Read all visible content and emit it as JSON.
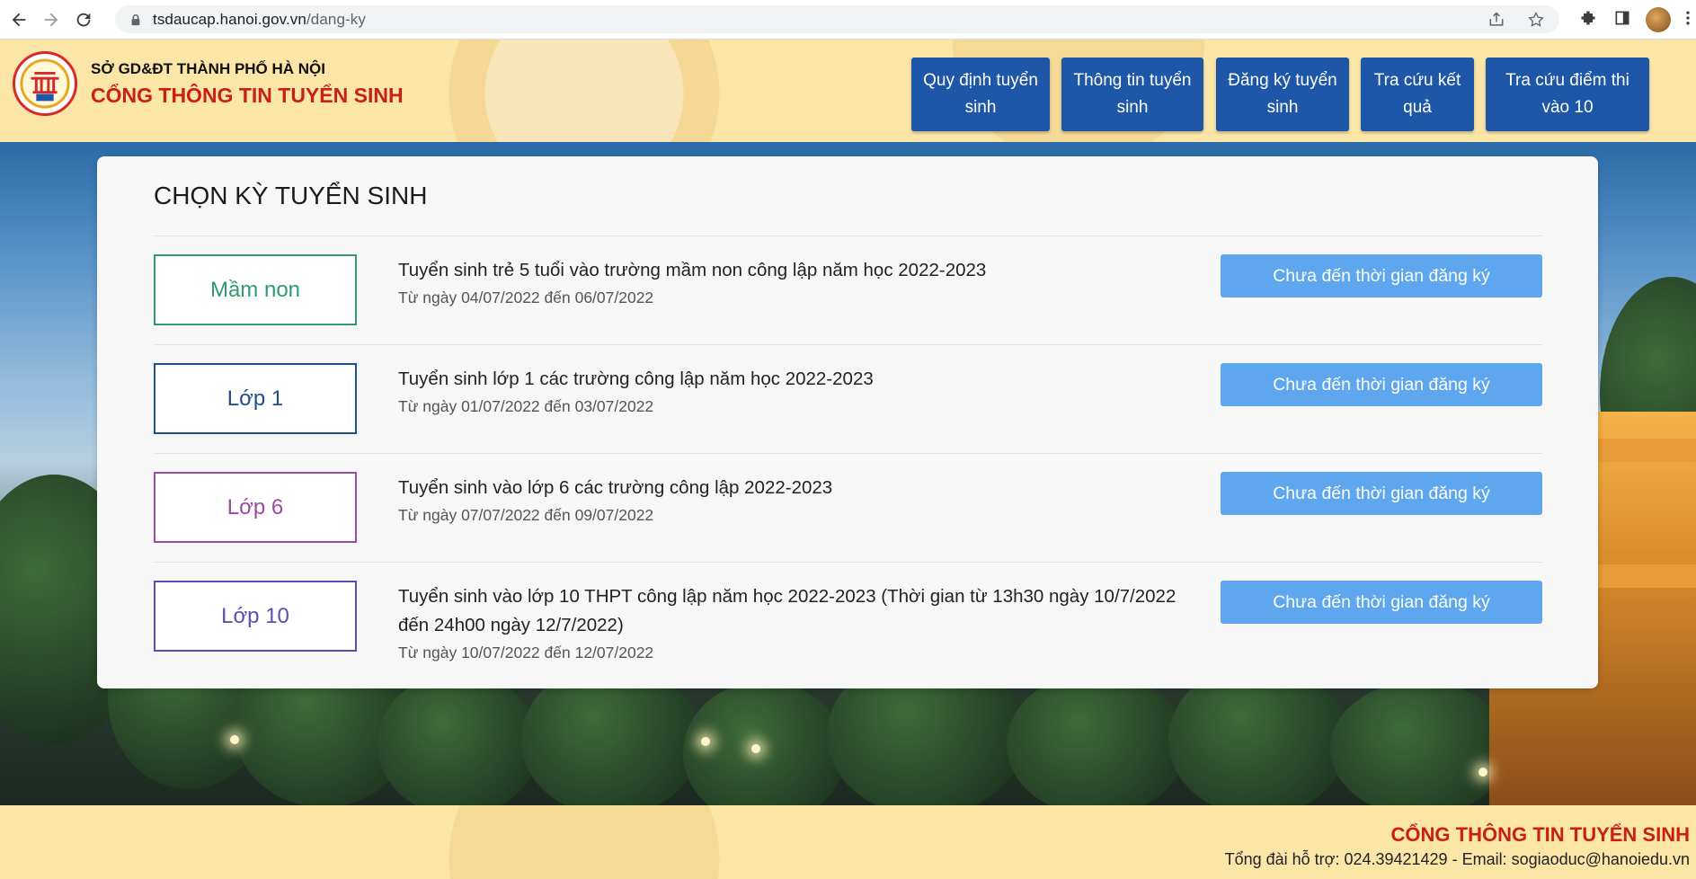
{
  "browser": {
    "url_host": "tsdaucap.hanoi.gov.vn",
    "url_path": "/dang-ky"
  },
  "header": {
    "org_name": "SỞ GD&ĐT THÀNH PHỐ HÀ NỘI",
    "portal_name": "CỔNG THÔNG TIN TUYỂN SINH",
    "nav": [
      {
        "label": "Quy định tuyển sinh"
      },
      {
        "label": "Thông tin tuyển sinh"
      },
      {
        "label": "Đăng ký tuyển sinh"
      },
      {
        "label": "Tra cứu kết quả"
      },
      {
        "label": "Tra cứu điểm thi vào 10"
      }
    ]
  },
  "main": {
    "title": "CHỌN KỲ TUYỂN SINH",
    "rows": [
      {
        "level": "Mầm non",
        "title": "Tuyển sinh trẻ 5 tuổi vào trường mầm non công lập năm học 2022-2023",
        "dates": "Từ ngày 04/07/2022 đến 06/07/2022",
        "button": "Chưa đến thời gian đăng ký",
        "color": "#2e9b6e"
      },
      {
        "level": "Lớp 1",
        "title": "Tuyển sinh lớp 1 các trường công lập năm học 2022-2023",
        "dates": "Từ ngày 01/07/2022 đến 03/07/2022",
        "button": "Chưa đến thời gian đăng ký",
        "color": "#1e4f8c"
      },
      {
        "level": "Lớp 6",
        "title": "Tuyển sinh vào lớp 6 các trường công lập 2022-2023",
        "dates": "Từ ngày 07/07/2022 đến 09/07/2022",
        "button": "Chưa đến thời gian đăng ký",
        "color": "#9b4aa6"
      },
      {
        "level": "Lớp 10",
        "title": "Tuyển sinh vào lớp 10 THPT công lập năm học 2022-2023 (Thời gian từ 13h30 ngày 10/7/2022 đến 24h00 ngày 12/7/2022)",
        "dates": "Từ ngày 10/07/2022 đến 12/07/2022",
        "button": "Chưa đến thời gian đăng ký",
        "color": "#5a4fb0"
      }
    ]
  },
  "footer": {
    "title": "CỔNG THÔNG TIN TUYỂN SINH",
    "contact": "Tổng đài hỗ trợ: 024.39421429 - Email: sogiaoduc@hanoiedu.vn"
  },
  "colors": {
    "nav_button": "#1f57a8",
    "action_button": "#5ea7ee",
    "brand_red": "#c82014",
    "header_bg": "#fbe6a8"
  }
}
